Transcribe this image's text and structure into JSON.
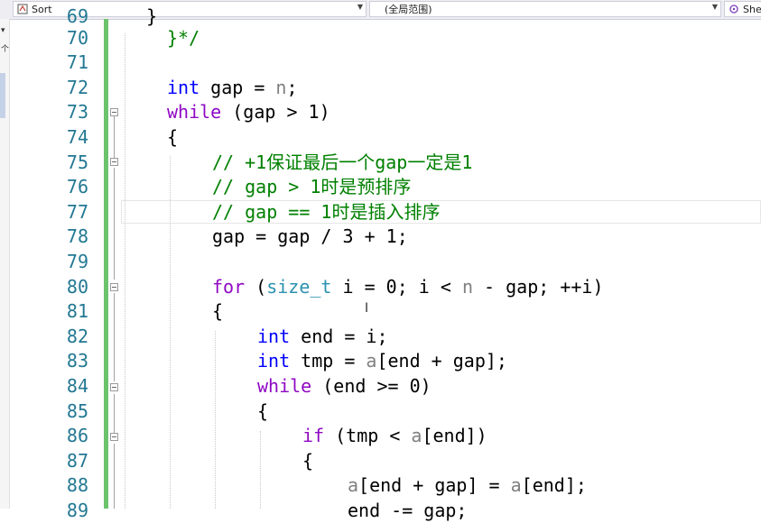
{
  "navbar": {
    "project": "Sort",
    "scope": "(全局范围)",
    "member": "Shel"
  },
  "left_strip": {
    "marks": [
      "▾",
      "个"
    ]
  },
  "line_numbers": [
    "69",
    "70",
    "71",
    "72",
    "73",
    "74",
    "75",
    "76",
    "77",
    "78",
    "79",
    "80",
    "81",
    "82",
    "83",
    "84",
    "85",
    "86",
    "87",
    "88",
    "89"
  ],
  "code_lines": [
    {
      "n": "69",
      "text": "  }"
    },
    {
      "n": "70",
      "text": "}*/"
    },
    {
      "n": "71",
      "text": ""
    },
    {
      "n": "72",
      "text": "int gap = n;"
    },
    {
      "n": "73",
      "text": "while (gap > 1)"
    },
    {
      "n": "74",
      "text": "{"
    },
    {
      "n": "75",
      "text": "// +1保证最后一个gap一定是1"
    },
    {
      "n": "76",
      "text": "// gap > 1时是预排序"
    },
    {
      "n": "77",
      "text": "// gap == 1时是插入排序"
    },
    {
      "n": "78",
      "text": "gap = gap / 3 + 1;"
    },
    {
      "n": "79",
      "text": ""
    },
    {
      "n": "80",
      "text": "for (size_t i = 0; i < n - gap; ++i)"
    },
    {
      "n": "81",
      "text": "{"
    },
    {
      "n": "82",
      "text": "int end = i;"
    },
    {
      "n": "83",
      "text": "int tmp = a[end + gap];"
    },
    {
      "n": "84",
      "text": "while (end >= 0)"
    },
    {
      "n": "85",
      "text": "{"
    },
    {
      "n": "86",
      "text": "if (tmp < a[end])"
    },
    {
      "n": "87",
      "text": "{"
    },
    {
      "n": "88",
      "text": "a[end + gap] = a[end];"
    },
    {
      "n": "89",
      "text": "end -= gap;"
    }
  ],
  "colors": {
    "keyword": "#0000ff",
    "control": "#8f08c4",
    "comment": "#008000",
    "type": "#2b91af",
    "parameter": "#808080",
    "line_number": "#237893",
    "change_bar": "#6cc36c"
  }
}
